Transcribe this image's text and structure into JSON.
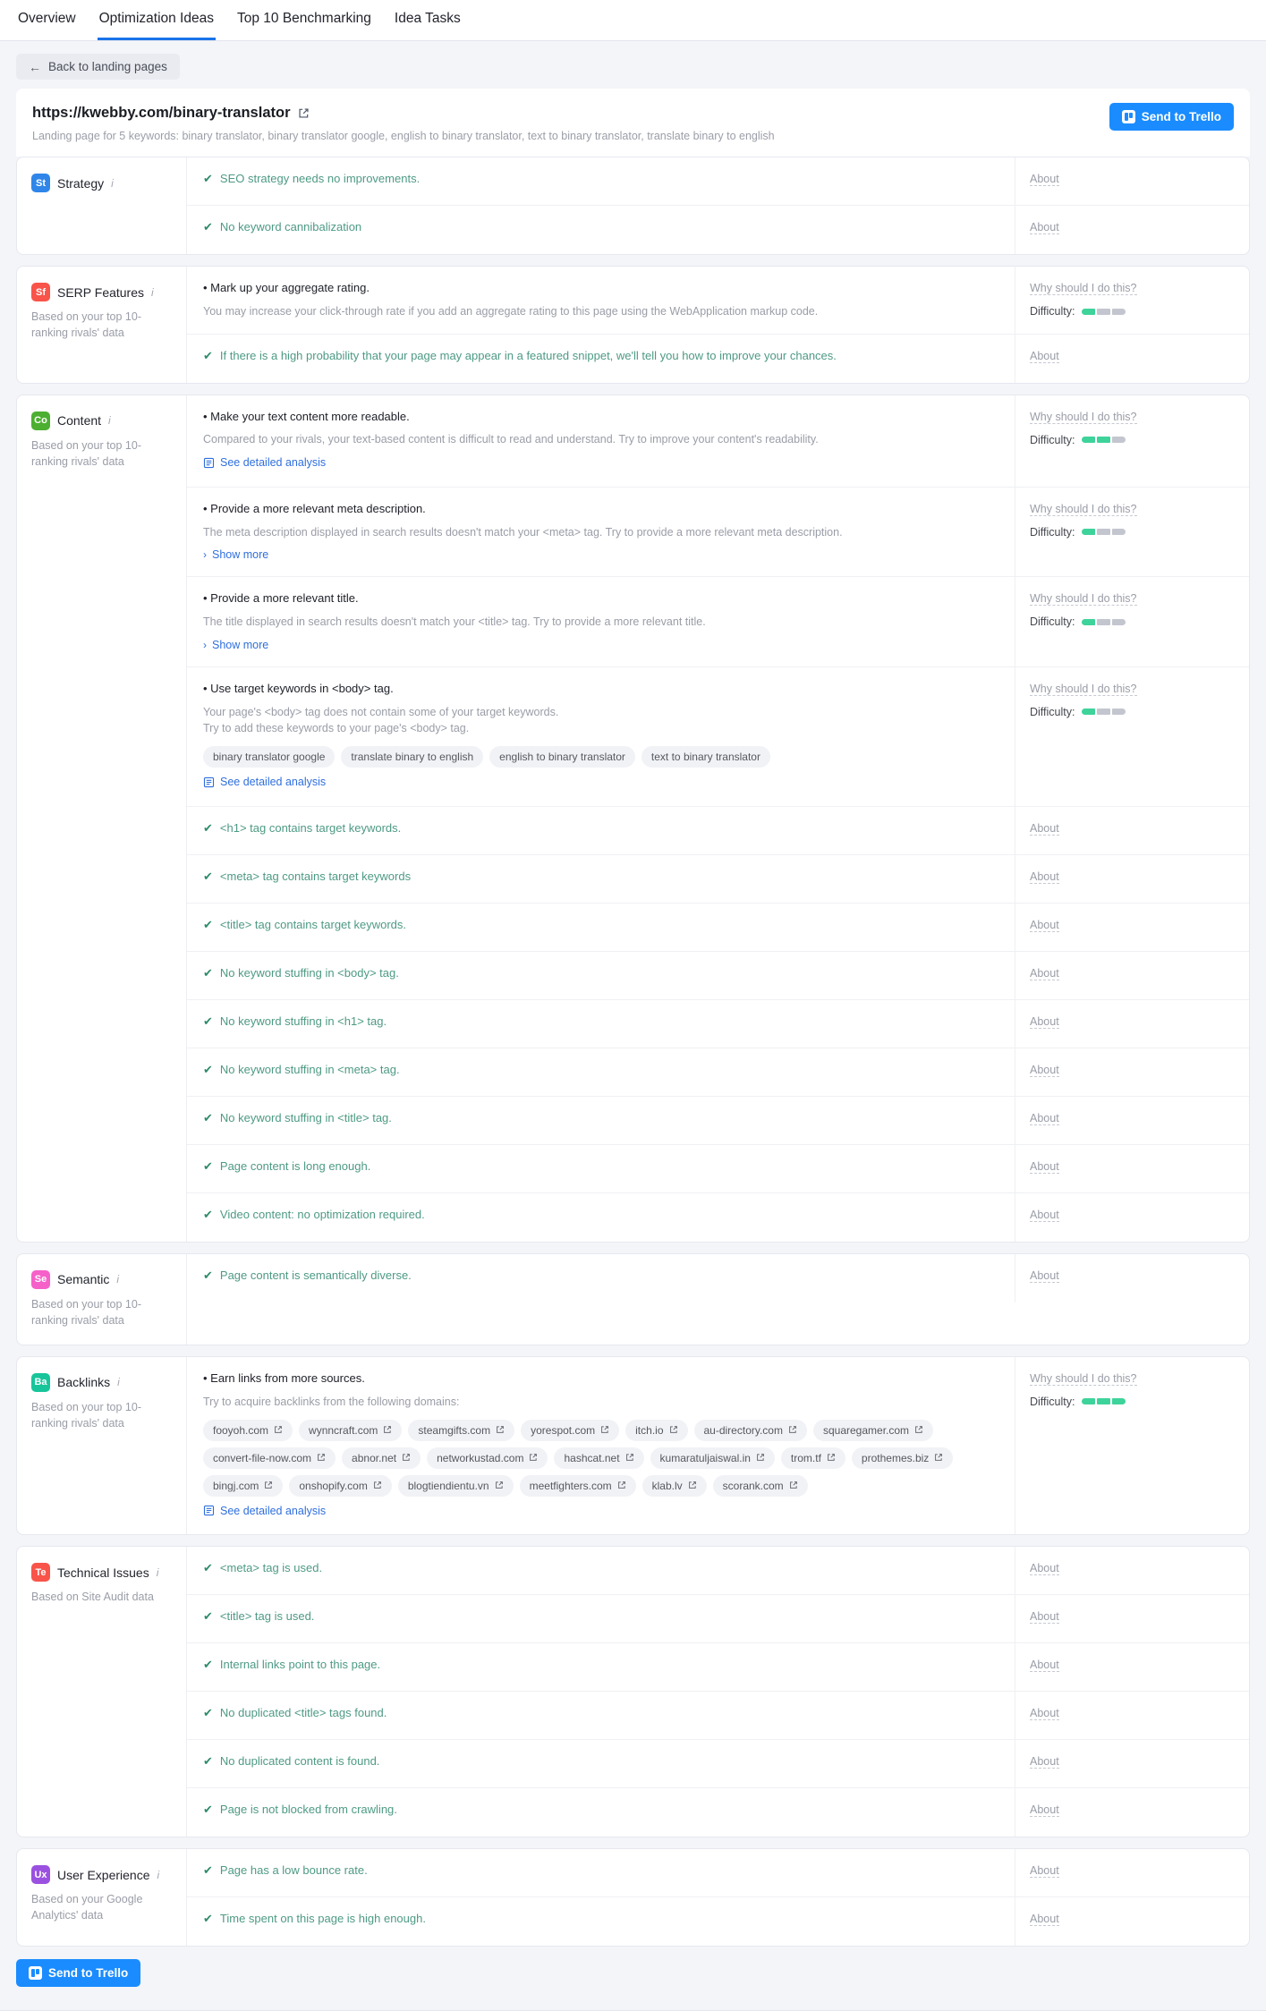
{
  "tabs": [
    {
      "label": "Overview",
      "active": false
    },
    {
      "label": "Optimization Ideas",
      "active": true
    },
    {
      "label": "Top 10 Benchmarking",
      "active": false
    },
    {
      "label": "Idea Tasks",
      "active": false
    }
  ],
  "back_button": {
    "label": "Back to landing pages",
    "icon": "arrow-left-icon"
  },
  "header": {
    "url": "https://kwebby.com/binary-translator",
    "external_icon": "external-link-icon",
    "subtitle": "Landing page for 5 keywords: binary translator, binary translator google, english to binary translator, text to binary translator, translate binary to english",
    "trello_button": "Send to Trello"
  },
  "labels": {
    "about": "About",
    "why": "Why should I do this?",
    "difficulty": "Difficulty:",
    "see_detailed_analysis": "See detailed analysis",
    "show_more": "Show more"
  },
  "colors": {
    "accent_blue": "#1a73e8",
    "trello_blue": "#1a8cff",
    "success_green": "#4e9a84",
    "difficulty_fill": "#3ed39a",
    "difficulty_empty": "#c3c6cf"
  },
  "sections": [
    {
      "badge": "St",
      "badge_color": "#2f86e8",
      "title": "Strategy",
      "note": "",
      "rows": [
        {
          "type": "ok",
          "text": "SEO strategy needs no improvements.",
          "side": "about"
        },
        {
          "type": "ok",
          "text": "No keyword cannibalization",
          "side": "about"
        }
      ]
    },
    {
      "badge": "Sf",
      "badge_color": "#f8544a",
      "title": "SERP Features",
      "note": "Based on your top 10-ranking rivals' data",
      "rows": [
        {
          "type": "idea",
          "title": "Mark up your aggregate rating.",
          "desc": "You may increase your click-through rate if you add an aggregate rating to this page using the WebApplication markup code.",
          "side": "why",
          "difficulty": 1,
          "difficulty_total": 3
        },
        {
          "type": "ok",
          "text": "If there is a high probability that your page may appear in a featured snippet, we'll tell you how to improve your chances.",
          "side": "about"
        }
      ]
    },
    {
      "badge": "Co",
      "badge_color": "#4caf31",
      "title": "Content",
      "note": "Based on your top 10-ranking rivals' data",
      "rows": [
        {
          "type": "idea",
          "title": "Make your text content more readable.",
          "desc": "Compared to your rivals, your text-based content is difficult to read and understand. Try to improve your content's readability.",
          "link": "See detailed analysis",
          "link_icon": "document-icon",
          "side": "why",
          "difficulty": 2,
          "difficulty_total": 3
        },
        {
          "type": "idea",
          "title": "Provide a more relevant meta description.",
          "desc": "The meta description displayed in search results doesn't match your <meta> tag. Try to provide a more relevant meta description.",
          "link": "Show more",
          "link_icon": "chevron-right-icon",
          "side": "why",
          "difficulty": 1,
          "difficulty_total": 3
        },
        {
          "type": "idea",
          "title": "Provide a more relevant title.",
          "desc": "The title displayed in search results doesn't match your <title> tag. Try to provide a more relevant title.",
          "link": "Show more",
          "link_icon": "chevron-right-icon",
          "side": "why",
          "difficulty": 1,
          "difficulty_total": 3
        },
        {
          "type": "idea",
          "title": "Use target keywords in <body> tag.",
          "desc": "Your page's <body> tag does not contain some of your target keywords.\nTry to add these keywords to your page's <body> tag.",
          "tags": [
            "binary translator google",
            "translate binary to english",
            "english to binary translator",
            "text to binary translator"
          ],
          "link": "See detailed analysis",
          "link_icon": "document-icon",
          "side": "why",
          "difficulty": 1,
          "difficulty_total": 3
        },
        {
          "type": "ok",
          "text": "<h1> tag contains target keywords.",
          "side": "about"
        },
        {
          "type": "ok",
          "text": "<meta> tag contains target keywords",
          "side": "about"
        },
        {
          "type": "ok",
          "text": "<title> tag contains target keywords.",
          "side": "about"
        },
        {
          "type": "ok",
          "text": "No keyword stuffing in <body> tag.",
          "side": "about"
        },
        {
          "type": "ok",
          "text": "No keyword stuffing in <h1> tag.",
          "side": "about"
        },
        {
          "type": "ok",
          "text": "No keyword stuffing in <meta> tag.",
          "side": "about"
        },
        {
          "type": "ok",
          "text": "No keyword stuffing in <title> tag.",
          "side": "about"
        },
        {
          "type": "ok",
          "text": "Page content is long enough.",
          "side": "about"
        },
        {
          "type": "ok",
          "text": "Video content: no optimization required.",
          "side": "about"
        }
      ]
    },
    {
      "badge": "Se",
      "badge_color": "#f561c9",
      "title": "Semantic",
      "note": "Based on your top 10-ranking rivals' data",
      "rows": [
        {
          "type": "ok",
          "text": "Page content is semantically diverse.",
          "side": "about"
        }
      ]
    },
    {
      "badge": "Ba",
      "badge_color": "#18c59a",
      "title": "Backlinks",
      "note": "Based on your top 10-ranking rivals' data",
      "rows": [
        {
          "type": "idea",
          "title": "Earn links from more sources.",
          "desc": "Try to acquire backlinks from the following domains:",
          "domains": [
            "fooyoh.com",
            "wynncraft.com",
            "steamgifts.com",
            "yorespot.com",
            "itch.io",
            "au-directory.com",
            "squaregamer.com",
            "convert-file-now.com",
            "abnor.net",
            "networkustad.com",
            "hashcat.net",
            "kumaratuljaiswal.in",
            "trom.tf",
            "prothemes.biz",
            "bingj.com",
            "onshopify.com",
            "blogtiendientu.vn",
            "meetfighters.com",
            "klab.lv",
            "scorank.com"
          ],
          "link": "See detailed analysis",
          "link_icon": "document-icon",
          "side": "why",
          "difficulty": 3,
          "difficulty_total": 3
        }
      ]
    },
    {
      "badge": "Te",
      "badge_color": "#f8544a",
      "title": "Technical Issues",
      "note": "Based on Site Audit data",
      "rows": [
        {
          "type": "ok",
          "text": "<meta> tag is used.",
          "side": "about"
        },
        {
          "type": "ok",
          "text": "<title> tag is used.",
          "side": "about"
        },
        {
          "type": "ok",
          "text": "Internal links point to this page.",
          "side": "about"
        },
        {
          "type": "ok",
          "text": "No duplicated <title> tags found.",
          "side": "about"
        },
        {
          "type": "ok",
          "text": "No duplicated content is found.",
          "side": "about"
        },
        {
          "type": "ok",
          "text": "Page is not blocked from crawling.",
          "side": "about"
        }
      ]
    },
    {
      "badge": "Ux",
      "badge_color": "#9b51e0",
      "title": "User Experience",
      "note": "Based on your Google Analytics' data",
      "rows": [
        {
          "type": "ok",
          "text": "Page has a low bounce rate.",
          "side": "about"
        },
        {
          "type": "ok",
          "text": "Time spent on this page is high enough.",
          "side": "about"
        }
      ]
    }
  ],
  "footer": {
    "trello_button": "Send to Trello"
  }
}
